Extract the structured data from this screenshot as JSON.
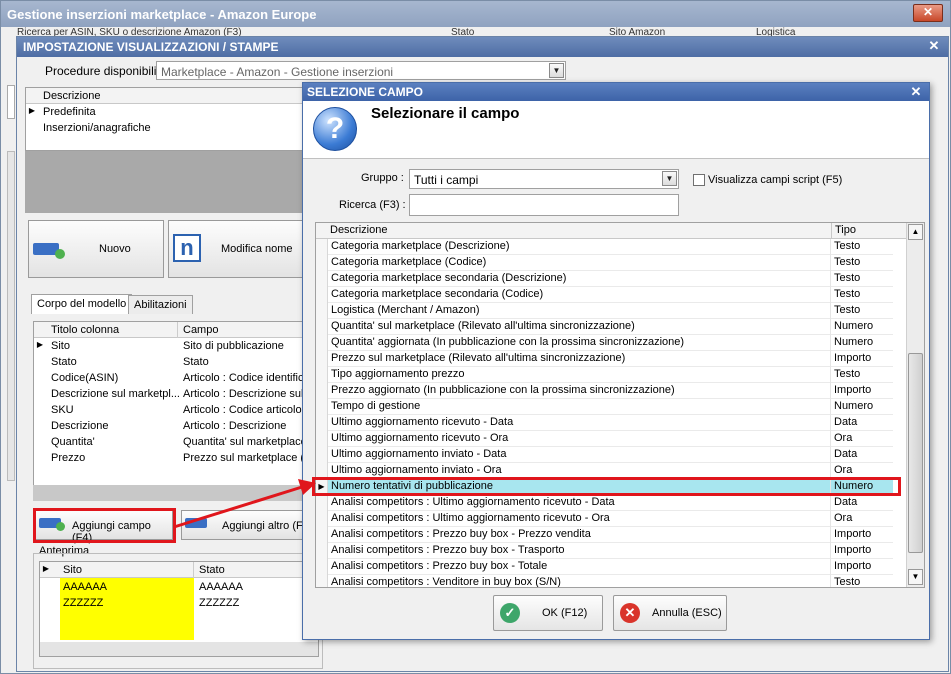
{
  "main": {
    "title": "Gestione inserzioni marketplace - Amazon Europe",
    "close_glyph": "✕",
    "filter_labels": [
      "Ricerca per ASIN, SKU o descrizione Amazon (F3)",
      "Stato",
      "Sito Amazon",
      "Logistica"
    ]
  },
  "settings": {
    "title": "IMPOSTAZIONE VISUALIZZAZIONI / STAMPE",
    "close_glyph": "✕",
    "procedure_label": "Procedure disponibili :",
    "procedure_value": "Marketplace - Amazon - Gestione inserzioni",
    "list_header": "Descrizione",
    "list_items": [
      "Predefinita",
      "Inserzioni/anagrafiche"
    ],
    "btn_new": "Nuovo",
    "btn_rename": "Modifica nome",
    "tabs": [
      "Corpo del modello",
      "Abilitazioni"
    ],
    "columns_grid": {
      "headers": [
        "Titolo colonna",
        "Campo"
      ],
      "rows": [
        [
          "Sito",
          "Sito di pubblicazione"
        ],
        [
          "Stato",
          "Stato"
        ],
        [
          "Codice(ASIN)",
          "Articolo : Codice identific"
        ],
        [
          "Descrizione sul marketpl...",
          "Articolo : Descrizione sul"
        ],
        [
          "SKU",
          "Articolo : Codice articolo"
        ],
        [
          "Descrizione",
          "Articolo : Descrizione"
        ],
        [
          "Quantita'",
          "Quantita' sul marketplace"
        ],
        [
          "Prezzo",
          "Prezzo sul marketplace (F"
        ]
      ]
    },
    "btn_add_field": "Aggiungi campo (F4)",
    "btn_add_other": "Aggiungi altro (F3",
    "preview_label": "Anteprima",
    "preview": {
      "headers": [
        "Sito",
        "Stato"
      ],
      "rows": [
        [
          "AAAAAA",
          "AAAAAA"
        ],
        [
          "ZZZZZZ",
          "ZZZZZZ"
        ]
      ]
    }
  },
  "selection": {
    "title": "SELEZIONE CAMPO",
    "close_glyph": "✕",
    "heading": "Selezionare il campo",
    "group_label": "Gruppo :",
    "group_value": "Tutti i campi",
    "script_checkbox": "Visualizza campi script (F5)",
    "search_label": "Ricerca (F3) :",
    "search_value": "",
    "table_headers": [
      "Descrizione",
      "Tipo"
    ],
    "rows": [
      {
        "desc": "Categoria marketplace (Descrizione)",
        "type": "Testo"
      },
      {
        "desc": "Categoria marketplace (Codice)",
        "type": "Testo"
      },
      {
        "desc": "Categoria marketplace secondaria (Descrizione)",
        "type": "Testo"
      },
      {
        "desc": "Categoria marketplace secondaria (Codice)",
        "type": "Testo"
      },
      {
        "desc": "Logistica (Merchant / Amazon)",
        "type": "Testo"
      },
      {
        "desc": "Quantita' sul marketplace (Rilevato all'ultima sincronizzazione)",
        "type": "Numero"
      },
      {
        "desc": "Quantita' aggiornata (In pubblicazione con la prossima sincronizzazione)",
        "type": "Numero"
      },
      {
        "desc": "Prezzo sul marketplace (Rilevato all'ultima sincronizzazione)",
        "type": "Importo"
      },
      {
        "desc": "Tipo aggiornamento prezzo",
        "type": "Testo"
      },
      {
        "desc": "Prezzo aggiornato (In pubblicazione con la prossima sincronizzazione)",
        "type": "Importo"
      },
      {
        "desc": "Tempo di gestione",
        "type": "Numero"
      },
      {
        "desc": "Ultimo aggiornamento ricevuto - Data",
        "type": "Data"
      },
      {
        "desc": "Ultimo aggiornamento ricevuto - Ora",
        "type": "Ora"
      },
      {
        "desc": "Ultimo aggiornamento inviato - Data",
        "type": "Data"
      },
      {
        "desc": "Ultimo aggiornamento inviato - Ora",
        "type": "Ora"
      },
      {
        "desc": "Numero tentativi di pubblicazione",
        "type": "Numero",
        "selected": true
      },
      {
        "desc": "Analisi competitors : Ultimo aggiornamento ricevuto - Data",
        "type": "Data"
      },
      {
        "desc": "Analisi competitors : Ultimo aggiornamento ricevuto - Ora",
        "type": "Ora"
      },
      {
        "desc": "Analisi competitors : Prezzo buy box - Prezzo vendita",
        "type": "Importo"
      },
      {
        "desc": "Analisi competitors : Prezzo buy box - Trasporto",
        "type": "Importo"
      },
      {
        "desc": "Analisi competitors : Prezzo buy box - Totale",
        "type": "Importo"
      },
      {
        "desc": "Analisi competitors : Venditore in buy box (S/N)",
        "type": "Testo"
      }
    ],
    "btn_ok": "OK (F12)",
    "btn_cancel": "Annulla (ESC)"
  },
  "colors": {
    "selected_row": "#a8e6ef",
    "highlight": "#e0161c",
    "preview_yellow": "#ffff00"
  }
}
